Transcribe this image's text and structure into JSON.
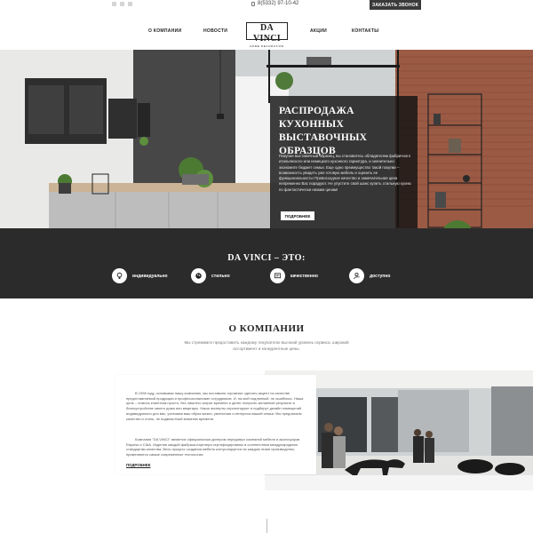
{
  "topbar": {
    "social_icons": [
      "vk-icon",
      "facebook-icon",
      "instagram-icon"
    ],
    "phone": "8(5332) 97-10-42",
    "callback_label": "ЗАКАЗАТЬ ЗВОНОК"
  },
  "nav": {
    "items": [
      "О КОМПАНИИ",
      "НОВОСТИ",
      "АКЦИИ",
      "КОНТАКТЫ"
    ],
    "logo_main": "DA VINCI",
    "logo_sub": "HOME DECORATION"
  },
  "hero": {
    "title": "РАСПРОДАЖА КУХОННЫХ ВЫСТАВОЧНЫХ ОБРАЗЦОВ",
    "text": "Покупая выставочный образец, вы становитесь обладателем фабричного итальянского или немецкого кухонного гарнитура, и значительно экономите бюджет семьи. Еще одно преимущество такой покупки – возможность увидеть уже готовую мебель и оценить ее функциональность! Превосходное качество и замечательная цена непременно Вас порадуют. Не упустите свой шанс купить стильную кухню по фантастически низким ценам!",
    "button": "ПОДРОБНЕЕ"
  },
  "features": {
    "title": "DA VINCI – ЭТО:",
    "items": [
      {
        "label": "индивидуально",
        "icon": "bulb-icon"
      },
      {
        "label": "стильно",
        "icon": "palette-icon"
      },
      {
        "label": "качественно",
        "icon": "certificate-icon"
      },
      {
        "label": "доступно",
        "icon": "hand-coin-icon"
      }
    ]
  },
  "about": {
    "title": "О КОМПАНИИ",
    "subtitle": "Мы стремимся предоставить каждому покупателю высокий уровень сервиса, широкий ассортимент и конкурентные цены.",
    "p1": "В 1998 году, основывая нашу компанию, мы поставили огромные сделать акцент на качестве предоставляемой продукции и профессионализме сотрудников. И, на мой подлинный, не ошиблись. Наша цель – помочь клиентам просто, без лишнего затрат времени и денег получить желанный результат в благоустройстве своего дома или квартиры. Наши эксперты спроектируют и подберут дизайн помещений индивидуально для вас, учитывая ваш образ жизни, увлечения и интересы вашей семьи. Мы предлагаем качество и стиль, не подвластный влиянию времени.",
    "p2": "Компания \"DA VINCI\" является официальным дилером передовых компаний мебели и аксессуаров Европы и США. Изделия каждой фабрики-партнера сертифицированы в соответствии международным стандартам качества. Весь процесс создания мебели контролируется на каждом этапе производства, применяются самые современные технологии.",
    "more": "ПОДРОБНЕЕ"
  }
}
